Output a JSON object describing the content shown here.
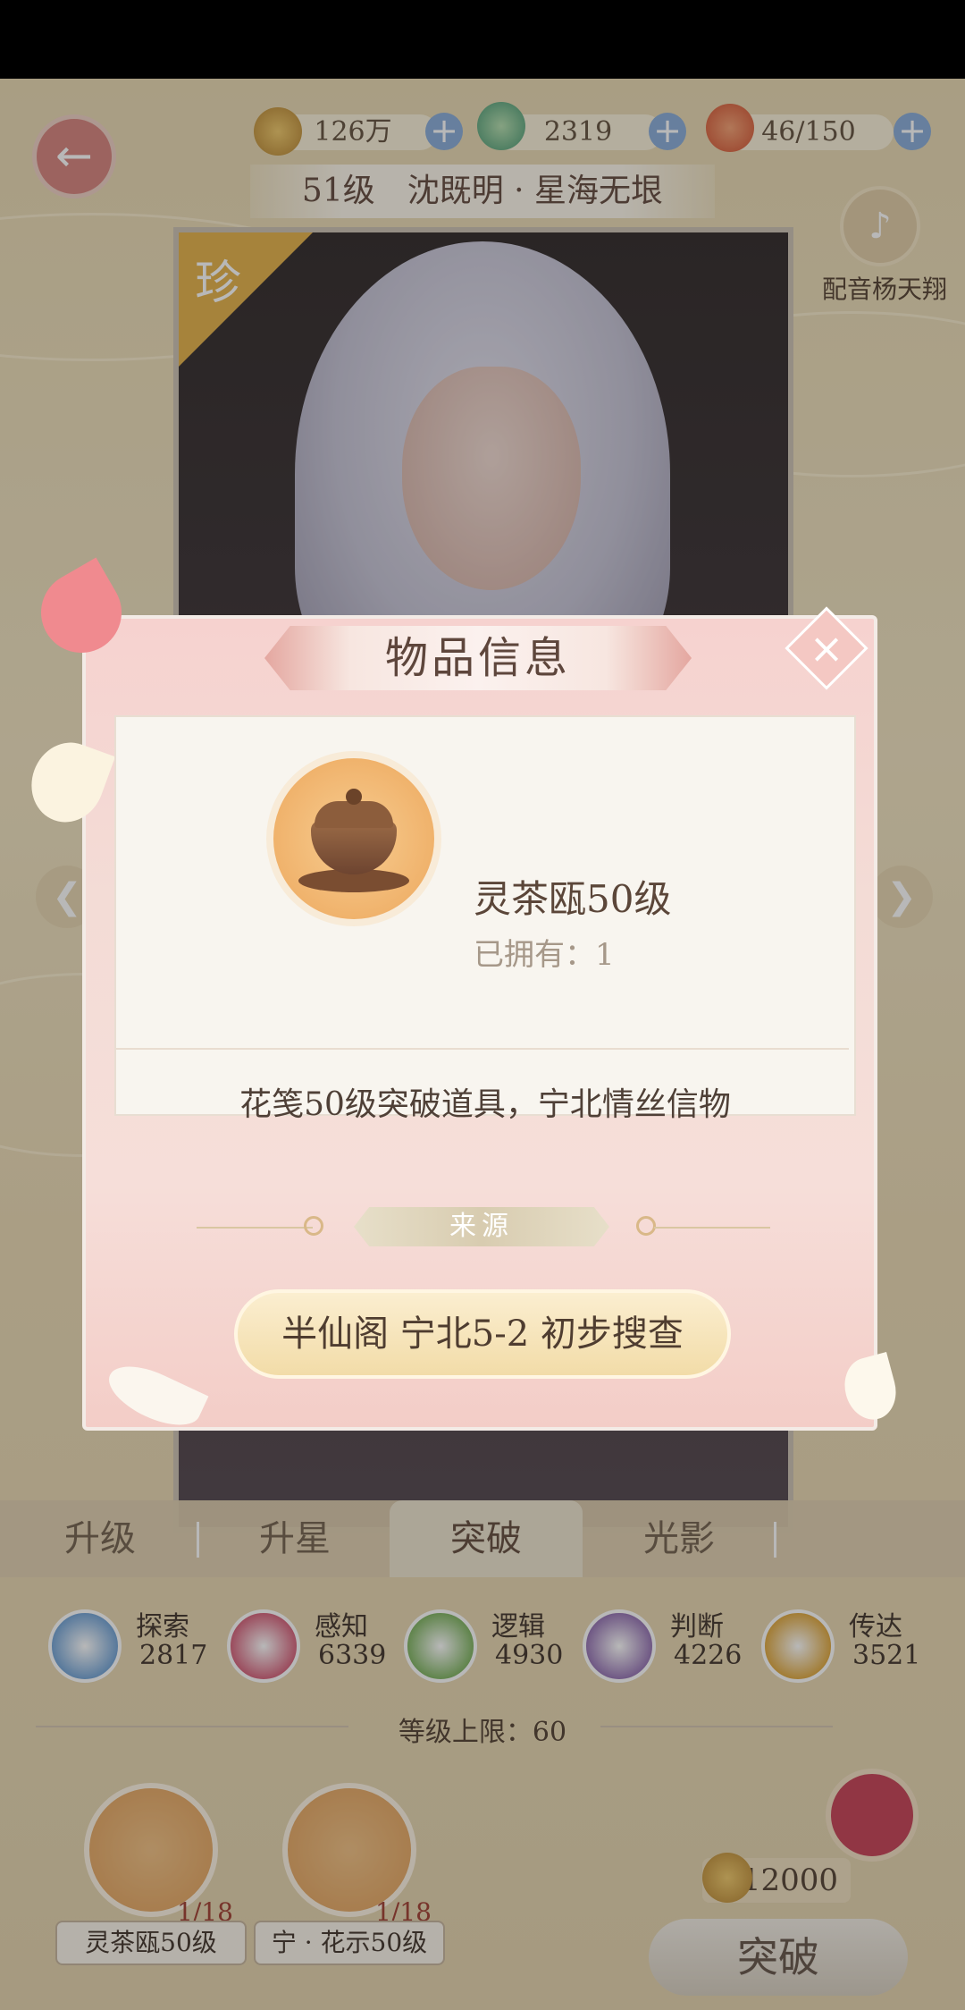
{
  "topbar": {
    "coins": "126万",
    "gems": "2319",
    "stamina": "46/150",
    "plus_symbol": "+"
  },
  "character": {
    "level_name": "51级　沈既明 · 星海无垠",
    "rarity": "珍",
    "voice_label": "配音杨天翔"
  },
  "tabs": [
    {
      "label": "升级"
    },
    {
      "label": "升星"
    },
    {
      "label": "突破"
    },
    {
      "label": "光影"
    }
  ],
  "attributes": [
    {
      "name": "探索",
      "value": "2817",
      "color": "#7aa8d8"
    },
    {
      "name": "感知",
      "value": "6339",
      "color": "#d76a82"
    },
    {
      "name": "逻辑",
      "value": "4930",
      "color": "#86b86a"
    },
    {
      "name": "判断",
      "value": "4226",
      "color": "#9b7bb8"
    },
    {
      "name": "传达",
      "value": "3521",
      "color": "#e1ad4a"
    }
  ],
  "level_limit": "等级上限：60",
  "materials": [
    {
      "count": "1/18",
      "label": "灵茶瓯50级"
    },
    {
      "count": "1/18",
      "label": "宁 · 花示50级"
    }
  ],
  "breakthrough": {
    "cost": "12000",
    "button_label": "突破"
  },
  "dialog": {
    "title": "物品信息",
    "close_symbol": "×",
    "item_name": "灵茶瓯50级",
    "owned": "已拥有：1",
    "description": "花笺50级突破道具，宁北情丝信物",
    "source_title": "来源",
    "source_button": "半仙阁 宁北5-2 初步搜查"
  }
}
